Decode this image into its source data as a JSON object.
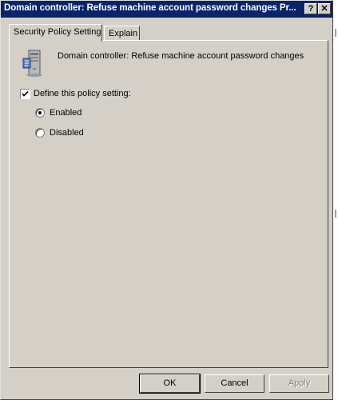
{
  "window": {
    "title": "Domain controller: Refuse machine account password changes Pr...",
    "help_glyph": "?",
    "close_glyph": "✕"
  },
  "tabs": [
    {
      "label": "Security Policy Setting",
      "active": true
    },
    {
      "label": "Explain",
      "active": false
    }
  ],
  "policy": {
    "name": "Domain controller: Refuse machine account password changes",
    "icon": "server-policy-icon"
  },
  "define_setting": {
    "label": "Define this policy setting:",
    "checked": true
  },
  "options": [
    {
      "label": "Enabled",
      "selected": true
    },
    {
      "label": "Disabled",
      "selected": false
    }
  ],
  "buttons": {
    "ok": "OK",
    "cancel": "Cancel",
    "apply": "Apply"
  }
}
